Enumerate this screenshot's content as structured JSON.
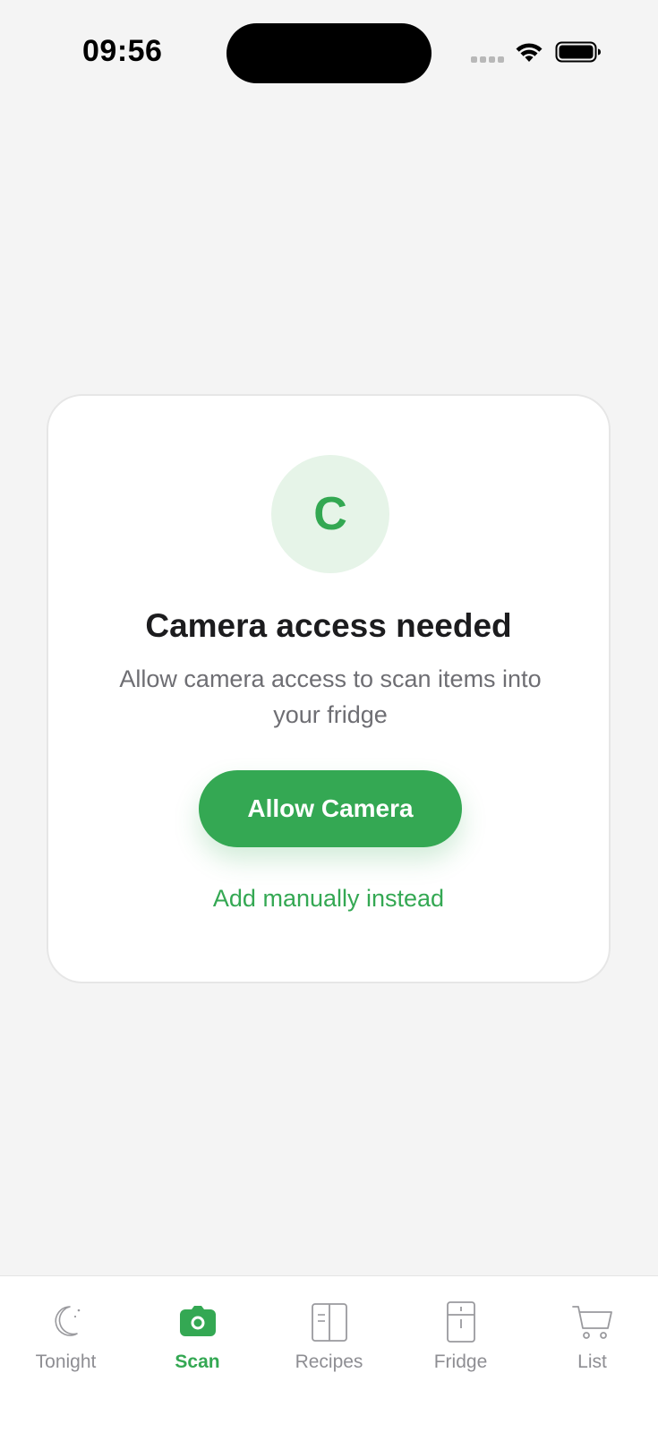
{
  "status_bar": {
    "time": "09:56"
  },
  "permission_card": {
    "avatar_letter": "C",
    "title": "Camera access needed",
    "description": "Allow camera access to scan items into your fridge",
    "primary_button": "Allow Camera",
    "secondary_link": "Add manually instead"
  },
  "tab_bar": {
    "tabs": [
      {
        "label": "Tonight",
        "icon": "moon-icon",
        "active": false
      },
      {
        "label": "Scan",
        "icon": "camera-icon",
        "active": true
      },
      {
        "label": "Recipes",
        "icon": "book-icon",
        "active": false
      },
      {
        "label": "Fridge",
        "icon": "fridge-icon",
        "active": false
      },
      {
        "label": "List",
        "icon": "cart-icon",
        "active": false
      }
    ]
  },
  "colors": {
    "accent": "#34a853",
    "background": "#f4f4f4",
    "avatar_bg": "#e6f4e8",
    "inactive": "#8e8e93"
  }
}
